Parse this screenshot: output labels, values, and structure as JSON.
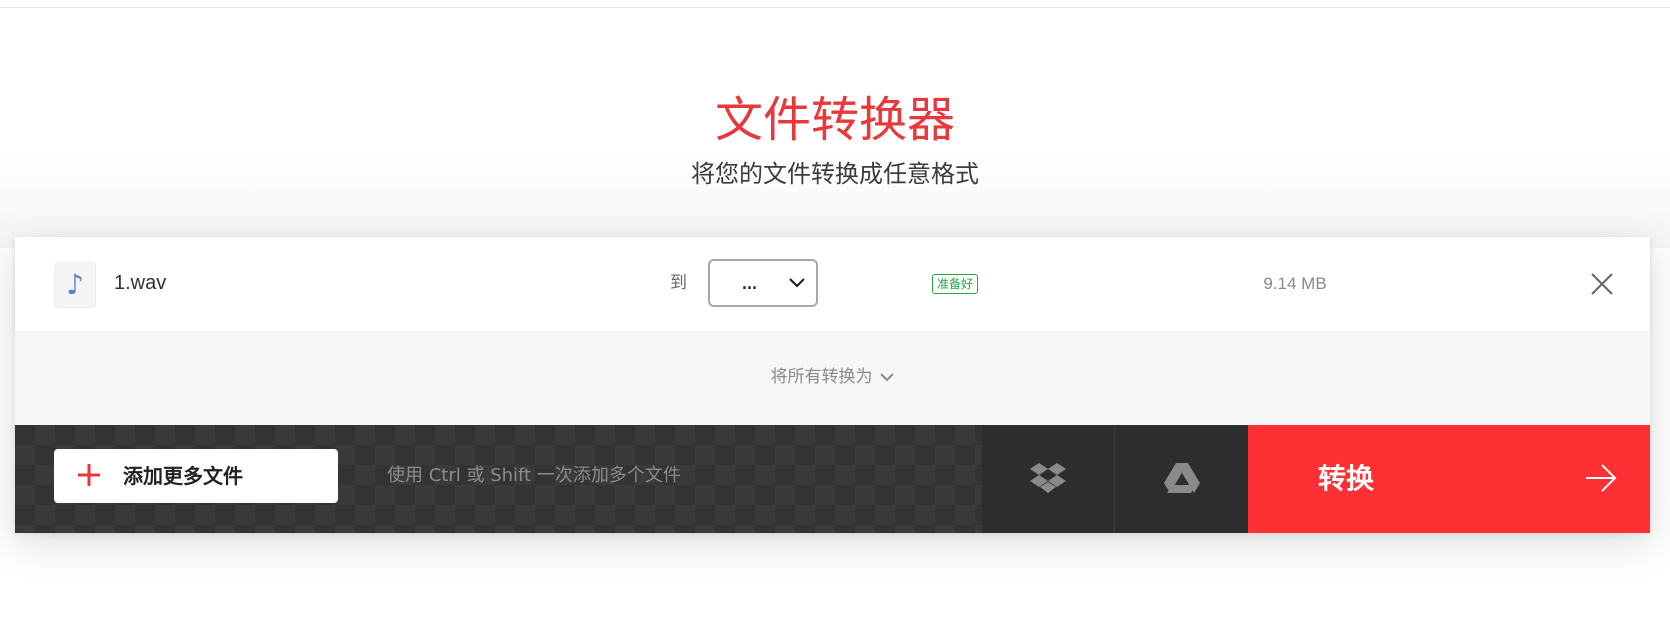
{
  "hero": {
    "title": "文件转换器",
    "subtitle": "将您的文件转换成任意格式"
  },
  "file": {
    "icon": "music-note-icon",
    "icon_glyph": "♪",
    "name": "1.wav",
    "to_label": "到",
    "format_value": "...",
    "status": "准备好",
    "size": "9.14 MB"
  },
  "convert_all": {
    "label": "将所有转换为"
  },
  "bottom": {
    "add_files_label": "添加更多文件",
    "hint": "使用 Ctrl 或 Shift 一次添加多个文件",
    "convert_label": "转换"
  },
  "colors": {
    "brand_red": "#ff3033",
    "title_red": "#e8383b",
    "status_green": "#2aa54a",
    "bar_dark": "#333333"
  }
}
